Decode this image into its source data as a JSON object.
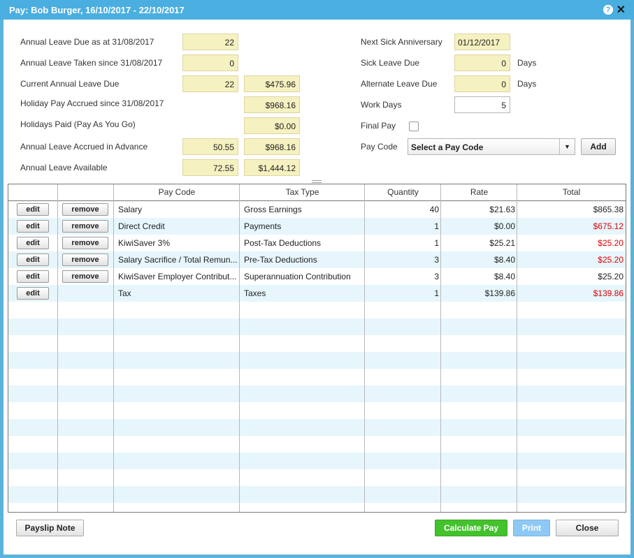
{
  "window": {
    "title": "Pay: Bob  Burger, 16/10/2017 - 22/10/2017",
    "help": "?",
    "close": "✕"
  },
  "left_fields": [
    {
      "label": "Annual Leave Due as at 31/08/2017",
      "v1": "22",
      "v2": null
    },
    {
      "label": "Annual Leave Taken since 31/08/2017",
      "v1": "0",
      "v2": null
    },
    {
      "label": "Current Annual Leave Due",
      "v1": "22",
      "v2": "$475.96"
    },
    {
      "label": "Holiday Pay Accrued since 31/08/2017",
      "v1": null,
      "v2": "$968.16"
    },
    {
      "label": "Holidays Paid (Pay As You Go)",
      "v1": null,
      "v2": "$0.00"
    },
    {
      "label": "Annual Leave Accrued in Advance",
      "v1": "50.55",
      "v2": "$968.16"
    },
    {
      "label": "Annual Leave Available",
      "v1": "72.55",
      "v2": "$1,444.12"
    }
  ],
  "right_fields": {
    "next_sick_label": "Next Sick Anniversary",
    "next_sick_value": "01/12/2017",
    "sick_due_label": "Sick Leave Due",
    "sick_due_value": "0",
    "sick_due_unit": "Days",
    "alt_due_label": "Alternate Leave Due",
    "alt_due_value": "0",
    "alt_due_unit": "Days",
    "work_days_label": "Work Days",
    "work_days_value": "5",
    "final_pay_label": "Final Pay",
    "pay_code_label": "Pay Code",
    "pay_code_select": "Select a Pay Code",
    "add_button": "Add"
  },
  "table": {
    "headers": [
      "",
      "",
      "Pay Code",
      "Tax Type",
      "Quantity",
      "Rate",
      "Total"
    ],
    "rows": [
      {
        "edit": "edit",
        "remove": "remove",
        "pay_code": "Salary",
        "tax_type": "Gross Earnings",
        "quantity": "40",
        "rate": "$21.63",
        "total": "$865.38",
        "total_red": false
      },
      {
        "edit": "edit",
        "remove": "remove",
        "pay_code": "Direct Credit",
        "tax_type": "Payments",
        "quantity": "1",
        "rate": "$0.00",
        "total": "$675.12",
        "total_red": true
      },
      {
        "edit": "edit",
        "remove": "remove",
        "pay_code": "KiwiSaver 3%",
        "tax_type": "Post-Tax Deductions",
        "quantity": "1",
        "rate": "$25.21",
        "total": "$25.20",
        "total_red": true
      },
      {
        "edit": "edit",
        "remove": "remove",
        "pay_code": "Salary Sacrifice / Total Remun...",
        "tax_type": "Pre-Tax Deductions",
        "quantity": "3",
        "rate": "$8.40",
        "total": "$25.20",
        "total_red": true
      },
      {
        "edit": "edit",
        "remove": "remove",
        "pay_code": "KiwiSaver Employer Contribut...",
        "tax_type": "Superannuation Contribution",
        "quantity": "3",
        "rate": "$8.40",
        "total": "$25.20",
        "total_red": false
      },
      {
        "edit": "edit",
        "remove": null,
        "pay_code": "Tax",
        "tax_type": "Taxes",
        "quantity": "1",
        "rate": "$139.86",
        "total": "$139.86",
        "total_red": true
      }
    ]
  },
  "footer": {
    "payslip_note": "Payslip Note",
    "calculate_pay": "Calculate Pay",
    "print": "Print",
    "close": "Close"
  },
  "colors": {
    "titlebar": "#4aaee0",
    "field_bg": "#f6f1c0",
    "row_alt": "#e6f6fc",
    "negative": "#e00000",
    "calc_btn": "#44c22d",
    "print_btn": "#8dc9f4"
  }
}
